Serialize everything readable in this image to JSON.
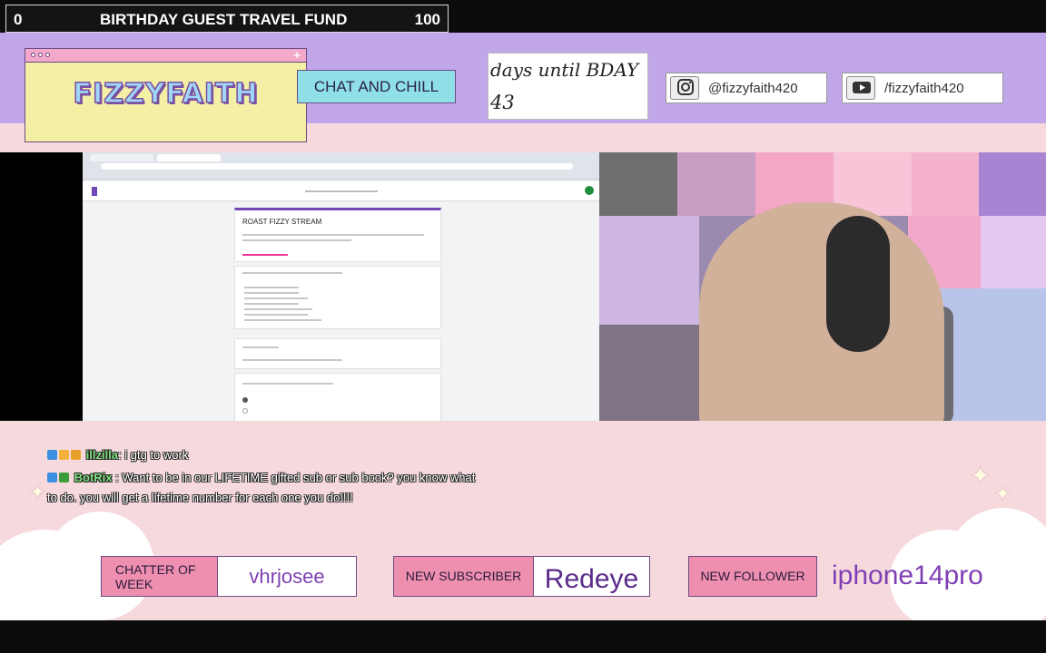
{
  "fund": {
    "left_value": "0",
    "title": "BIRTHDAY GUEST TRAVEL FUND",
    "right_value": "100"
  },
  "brand": {
    "logo_text": "FIZZYFAITH",
    "plus": "+"
  },
  "stream_title": "CHAT AND CHILL",
  "countdown": {
    "label": "days until BDAY",
    "value": "43"
  },
  "socials": [
    {
      "icon": "instagram-icon",
      "handle": "@fizzyfaith420"
    },
    {
      "icon": "youtube-icon",
      "handle": "/fizzyfaith420"
    }
  ],
  "screen_capture": {
    "form_title": "ROAST FIZZY STREAM"
  },
  "chat": [
    {
      "user": "illzilla",
      "separator": ": ",
      "message": "i gtg to work",
      "user_color": "#7fe07f"
    },
    {
      "user": "BotRix",
      "separator": " : ",
      "message": "Want to be in our LIFETIME gifted sub or sub book? you know what",
      "user_color": "#7fe07f"
    }
  ],
  "chat_continuation": "to do. you will get a lifetime number for each one you do!!!!",
  "alerts": {
    "chatter_label": "CHATTER OF WEEK",
    "chatter_value": "vhrjosee",
    "subscriber_label": "NEW SUBSCRIBER",
    "subscriber_value": "Redeye",
    "follower_label": "NEW FOLLOWER",
    "follower_value": "iphone14pro"
  },
  "colors": {
    "band_purple": "#c2a6ea",
    "pink_bg": "#f6d9dc",
    "logo_yellow": "#f3f0a6",
    "accent_cyan": "#8ee0e6",
    "label_pink": "#ee8fb0",
    "value_purple": "#7e3fb4"
  }
}
